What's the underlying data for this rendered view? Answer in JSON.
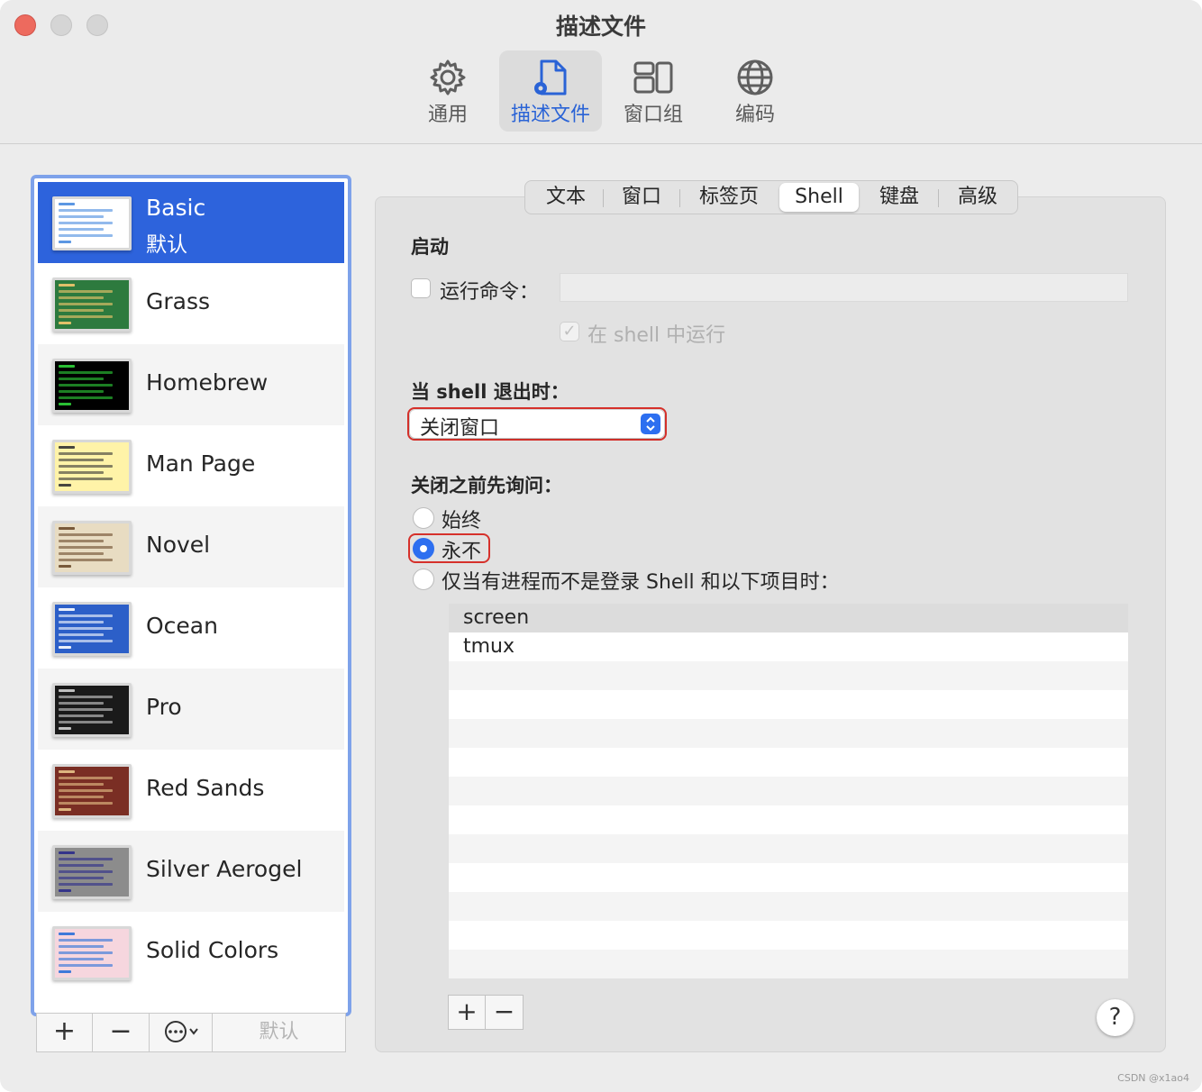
{
  "window": {
    "title": "描述文件"
  },
  "toolbar": [
    {
      "label": "通用",
      "icon": "gear-icon"
    },
    {
      "label": "描述文件",
      "icon": "profile-doc-icon"
    },
    {
      "label": "窗口组",
      "icon": "window-group-icon"
    },
    {
      "label": "编码",
      "icon": "globe-icon"
    }
  ],
  "profiles": [
    {
      "name": "Basic",
      "sub": "默认",
      "bg": "#ffffff",
      "fg": "#4a8ce0"
    },
    {
      "name": "Grass",
      "bg": "#2d7a3e",
      "fg": "#f5c86e"
    },
    {
      "name": "Homebrew",
      "bg": "#000000",
      "fg": "#2fd43a"
    },
    {
      "name": "Man Page",
      "bg": "#fff3a8",
      "fg": "#333333"
    },
    {
      "name": "Novel",
      "bg": "#e8dcc2",
      "fg": "#6b4a2a"
    },
    {
      "name": "Ocean",
      "bg": "#2c5fc8",
      "fg": "#ffffff"
    },
    {
      "name": "Pro",
      "bg": "#1a1a1a",
      "fg": "#d0d0d0"
    },
    {
      "name": "Red Sands",
      "bg": "#7a2e24",
      "fg": "#e8c48a"
    },
    {
      "name": "Silver Aerogel",
      "bg": "#8c8c8c",
      "fg": "#2a2a8a"
    },
    {
      "name": "Solid Colors",
      "bg": "#f6d6de",
      "fg": "#2a6fd8"
    }
  ],
  "list_buttons": {
    "add": "+",
    "remove": "−",
    "more": "⋯",
    "default": "默认"
  },
  "tabs": [
    "文本",
    "窗口",
    "标签页",
    "Shell",
    "键盘",
    "高级"
  ],
  "shell": {
    "startup_title": "启动",
    "run_command_label": "运行命令：",
    "run_command_value": "",
    "run_in_shell_label": "在 shell 中运行",
    "on_exit_title": "当 shell 退出时：",
    "on_exit_value": "关闭窗口",
    "ask_before_close_title": "关闭之前先询问：",
    "options": [
      "始终",
      "永不",
      "仅当有进程而不是登录 Shell 和以下项目时："
    ],
    "selected_option": 1,
    "processes": [
      "screen",
      "tmux"
    ],
    "add_label": "+",
    "remove_label": "−",
    "help_label": "?"
  },
  "watermark": "CSDN @x1ao4",
  "colors": {
    "accent": "#2d6ff0",
    "selection": "#2d63dc",
    "highlight": "#d6312b"
  }
}
